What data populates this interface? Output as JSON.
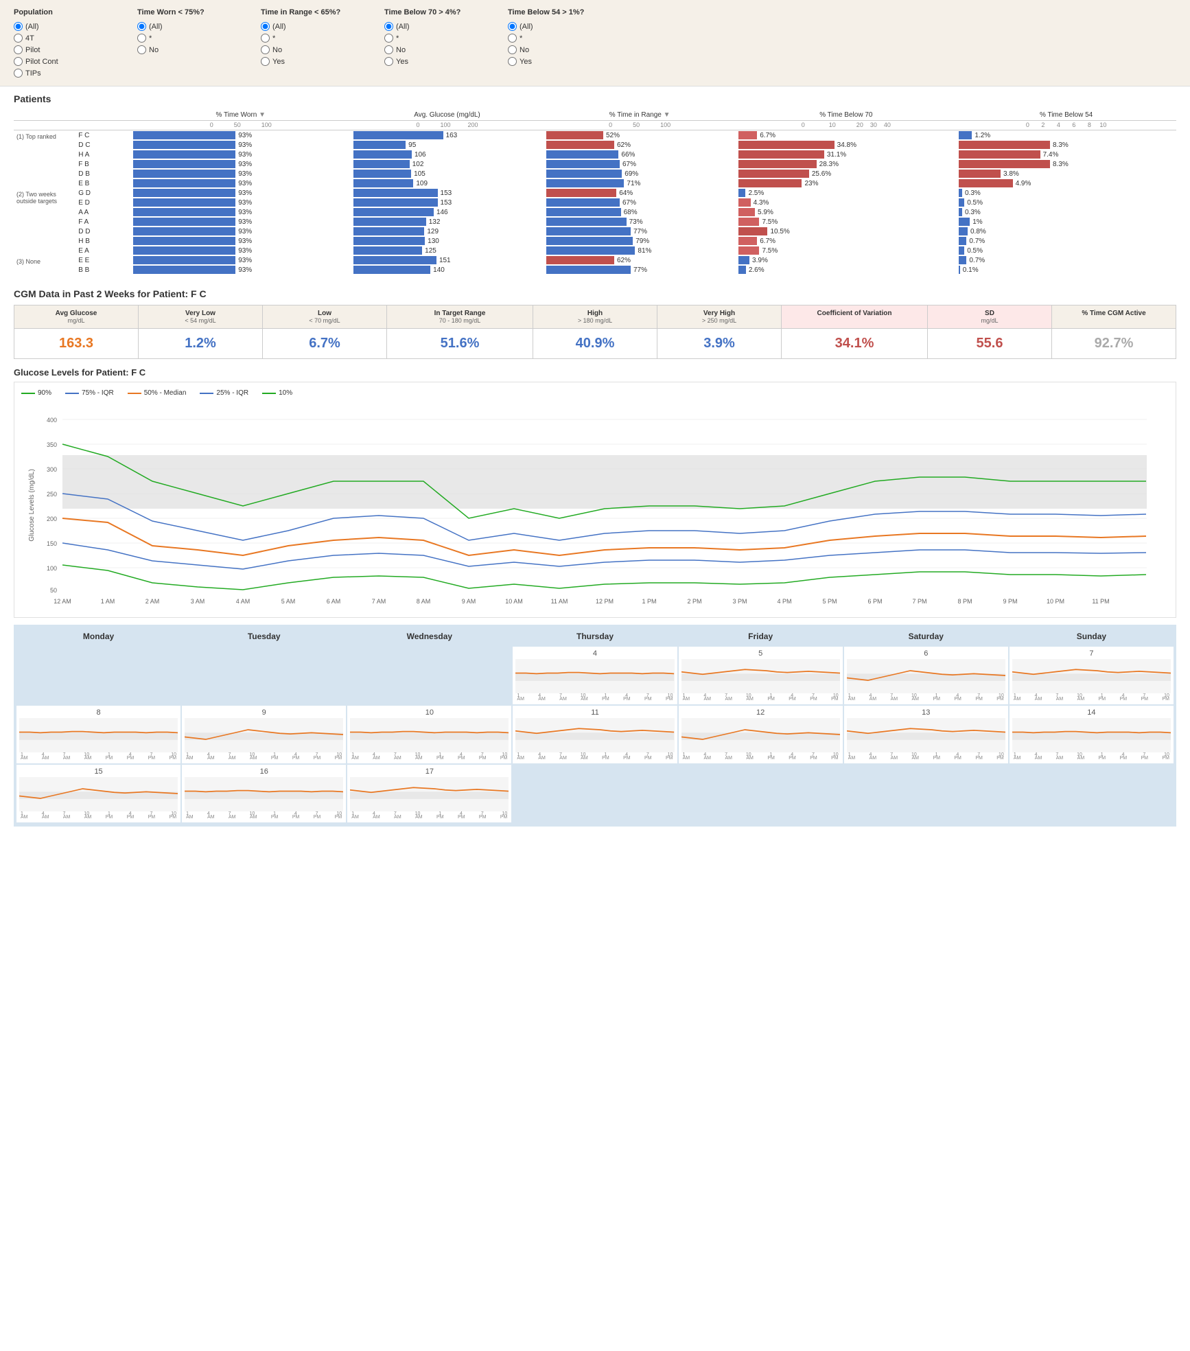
{
  "filters": {
    "population": {
      "label": "Population",
      "options": [
        "(All)",
        "4T",
        "Pilot",
        "Pilot Cont",
        "TIPs"
      ],
      "selected": "(All)"
    },
    "timeWorn": {
      "label": "Time Worn < 75%?",
      "options": [
        "(All)",
        "*",
        "No"
      ],
      "selected": "(All)"
    },
    "timeInRange": {
      "label": "Time in Range < 65%?",
      "options": [
        "(All)",
        "*",
        "No",
        "Yes"
      ],
      "selected": "(All)"
    },
    "timeBelow70": {
      "label": "Time Below 70 > 4%?",
      "options": [
        "(All)",
        "*",
        "No",
        "Yes"
      ],
      "selected": "(All)"
    },
    "timeBelow54": {
      "label": "Time Below 54 > 1%?",
      "options": [
        "(All)",
        "*",
        "No",
        "Yes"
      ],
      "selected": "(All)"
    }
  },
  "patients_title": "Patients",
  "table_headers": {
    "time_worn": "% Time Worn",
    "avg_glucose": "Avg. Glucose (mg/dL)",
    "time_in_range": "% Time in Range",
    "time_below_70": "% Time Below 70",
    "time_below_54": "% Time Below 54"
  },
  "groups": [
    {
      "label": "(1) Top ranked",
      "patients": [
        {
          "name": "F C",
          "time_worn": 93,
          "avg_glucose": 163,
          "time_in_range": 52,
          "time_below_70": 6.7,
          "time_below_54": 1.2
        },
        {
          "name": "D C",
          "time_worn": 93,
          "avg_glucose": 95,
          "time_in_range": 62,
          "time_below_70": 34.8,
          "time_below_54": 8.3
        },
        {
          "name": "H A",
          "time_worn": 93,
          "avg_glucose": 106,
          "time_in_range": 66,
          "time_below_70": 31.1,
          "time_below_54": 7.4
        },
        {
          "name": "F B",
          "time_worn": 93,
          "avg_glucose": 102,
          "time_in_range": 67,
          "time_below_70": 28.3,
          "time_below_54": 8.3
        },
        {
          "name": "D B",
          "time_worn": 93,
          "avg_glucose": 105,
          "time_in_range": 69,
          "time_below_70": 25.6,
          "time_below_54": 3.8
        },
        {
          "name": "E B",
          "time_worn": 93,
          "avg_glucose": 109,
          "time_in_range": 71,
          "time_below_70": 23.0,
          "time_below_54": 4.9
        }
      ]
    },
    {
      "label": "(2) Two weeks outside targets",
      "patients": [
        {
          "name": "G D",
          "time_worn": 93,
          "avg_glucose": 153,
          "time_in_range": 64,
          "time_below_70": 2.5,
          "time_below_54": 0.3
        },
        {
          "name": "E D",
          "time_worn": 93,
          "avg_glucose": 153,
          "time_in_range": 67,
          "time_below_70": 4.3,
          "time_below_54": 0.5
        },
        {
          "name": "A A",
          "time_worn": 93,
          "avg_glucose": 146,
          "time_in_range": 68,
          "time_below_70": 5.9,
          "time_below_54": 0.3
        },
        {
          "name": "F A",
          "time_worn": 93,
          "avg_glucose": 132,
          "time_in_range": 73,
          "time_below_70": 7.5,
          "time_below_54": 1.0
        },
        {
          "name": "D D",
          "time_worn": 93,
          "avg_glucose": 129,
          "time_in_range": 77,
          "time_below_70": 10.5,
          "time_below_54": 0.8
        },
        {
          "name": "H B",
          "time_worn": 93,
          "avg_glucose": 130,
          "time_in_range": 79,
          "time_below_70": 6.7,
          "time_below_54": 0.7
        },
        {
          "name": "E A",
          "time_worn": 93,
          "avg_glucose": 125,
          "time_in_range": 81,
          "time_below_70": 7.5,
          "time_below_54": 0.5
        }
      ]
    },
    {
      "label": "(3) None",
      "patients": [
        {
          "name": "E E",
          "time_worn": 93,
          "avg_glucose": 151,
          "time_in_range": 62,
          "time_below_70": 3.9,
          "time_below_54": 0.7
        },
        {
          "name": "B B",
          "time_worn": 93,
          "avg_glucose": 140,
          "time_in_range": 77,
          "time_below_70": 2.6,
          "time_below_54": 0.1
        }
      ]
    }
  ],
  "cgm": {
    "title": "CGM Data in Past 2 Weeks for Patient: F C",
    "stats": [
      {
        "label": "Avg Glucose",
        "sublabel": "mg/dL",
        "value": "163.3",
        "color": "orange"
      },
      {
        "label": "Very Low",
        "sublabel": "< 54 mg/dL",
        "value": "1.2%",
        "color": "blue"
      },
      {
        "label": "Low",
        "sublabel": "< 70 mg/dL",
        "value": "6.7%",
        "color": "blue"
      },
      {
        "label": "In Target Range",
        "sublabel": "70 - 180 mg/dL",
        "value": "51.6%",
        "color": "blue"
      },
      {
        "label": "High",
        "sublabel": "> 180 mg/dL",
        "value": "40.9%",
        "color": "blue"
      },
      {
        "label": "Very High",
        "sublabel": "> 250 mg/dL",
        "value": "3.9%",
        "color": "blue"
      },
      {
        "label": "Coefficient of Variation",
        "sublabel": "",
        "value": "34.1%",
        "color": "red"
      },
      {
        "label": "SD",
        "sublabel": "mg/dL",
        "value": "55.6",
        "color": "red"
      },
      {
        "label": "% Time CGM Active",
        "sublabel": "",
        "value": "92.7%",
        "color": "gray"
      }
    ]
  },
  "glucose_chart": {
    "title": "Glucose Levels for Patient: F C",
    "y_max": 400,
    "y_min": 50,
    "legend": [
      {
        "label": "90%",
        "color": "#22aa22"
      },
      {
        "label": "75% - IQR",
        "color": "#4472c4"
      },
      {
        "label": "50% - Median",
        "color": "#e87722"
      },
      {
        "label": "25% - IQR",
        "color": "#4472c4"
      },
      {
        "label": "10%",
        "color": "#22aa22"
      }
    ],
    "x_labels": [
      "12 AM",
      "1 AM",
      "2 AM",
      "3 AM",
      "4 AM",
      "5 AM",
      "6 AM",
      "7 AM",
      "8 AM",
      "9 AM",
      "10 AM",
      "11 AM",
      "12 PM",
      "1 PM",
      "2 PM",
      "3 PM",
      "4 PM",
      "5 PM",
      "6 PM",
      "7 PM",
      "8 PM",
      "9 PM",
      "10 PM",
      "11 PM"
    ]
  },
  "weekly": {
    "days": [
      "Monday",
      "Tuesday",
      "Wednesday",
      "Thursday",
      "Friday",
      "Saturday",
      "Sunday"
    ],
    "rows": [
      [
        {
          "date": "",
          "empty": true
        },
        {
          "date": "",
          "empty": true
        },
        {
          "date": "",
          "empty": true
        },
        {
          "date": "4",
          "empty": false
        },
        {
          "date": "5",
          "empty": false
        },
        {
          "date": "6",
          "empty": false
        },
        {
          "date": "7",
          "empty": false
        }
      ],
      [
        {
          "date": "8",
          "empty": false
        },
        {
          "date": "9",
          "empty": false
        },
        {
          "date": "10",
          "empty": false
        },
        {
          "date": "11",
          "empty": false
        },
        {
          "date": "12",
          "empty": false
        },
        {
          "date": "13",
          "empty": false
        },
        {
          "date": "14",
          "empty": false
        }
      ],
      [
        {
          "date": "15",
          "empty": false
        },
        {
          "date": "16",
          "empty": false
        },
        {
          "date": "17",
          "empty": false
        },
        {
          "date": "",
          "empty": true
        },
        {
          "date": "",
          "empty": true
        },
        {
          "date": "",
          "empty": true
        },
        {
          "date": "",
          "empty": true
        }
      ]
    ],
    "time_labels": [
      "1",
      "4",
      "7",
      "10",
      "1",
      "4",
      "7",
      "10"
    ],
    "time_sublabels": [
      "AM",
      "AM",
      "AM",
      "AM",
      "PM",
      "PM",
      "PM",
      "PM"
    ]
  }
}
